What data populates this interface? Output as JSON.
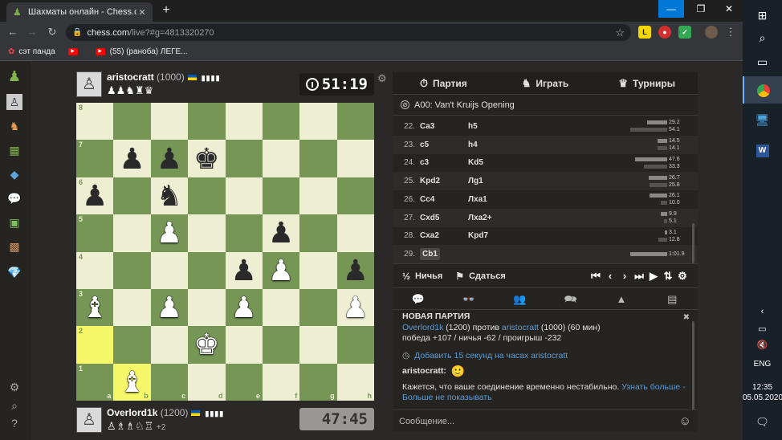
{
  "browser": {
    "tab_title": "Шахматы онлайн - Chess.com",
    "url_host": "chess.com",
    "url_path": "/live?#g=4813320270",
    "bookmarks": [
      "сэт панда",
      "",
      "(55) (раноба) ЛЕГЕ..."
    ]
  },
  "system": {
    "lang": "ENG",
    "time": "12:35",
    "date": "05.05.2020"
  },
  "top_player": {
    "name": "aristocratt",
    "rating": "(1000)",
    "captured": "♟♟♞♜♛",
    "clock": "51:19"
  },
  "bottom_player": {
    "name": "Overlord1k",
    "rating": "(1200)",
    "captured": "♙♗♗♘♖",
    "plus": "+2",
    "clock": "47:45"
  },
  "board": {
    "ranks": [
      "8",
      "7",
      "6",
      "5",
      "4",
      "3",
      "2",
      "1"
    ],
    "files": [
      "a",
      "b",
      "c",
      "d",
      "e",
      "f",
      "g",
      "h"
    ],
    "highlight": [
      "a2",
      "b1"
    ],
    "pieces": {
      "b7": "bp",
      "c7": "bp",
      "d7": "bk",
      "a6": "bp",
      "c6": "bn",
      "c5": "wp",
      "f5": "bp",
      "e4": "bp",
      "f4": "wp",
      "h4": "bp",
      "a3": "wb",
      "c3": "wp",
      "e3": "wp",
      "h3": "wp",
      "d2": "wk",
      "b1": "wb"
    }
  },
  "tabs": [
    {
      "icon": "⏱",
      "label": "Партия"
    },
    {
      "icon": "♞",
      "label": "Играть"
    },
    {
      "icon": "♛",
      "label": "Турниры"
    }
  ],
  "opening": "A00: Van't Kruijs Opening",
  "moves": [
    {
      "n": "22.",
      "w": "Ca3",
      "b": "h5",
      "tw": "29.2",
      "tb": "54.1",
      "fw": 0.54,
      "fb": 1.0
    },
    {
      "n": "23.",
      "w": "c5",
      "b": "h4",
      "tw": "14.5",
      "tb": "14.1",
      "fw": 0.27,
      "fb": 0.26
    },
    {
      "n": "24.",
      "w": "c3",
      "b": "Kd5",
      "tw": "47.6",
      "tb": "33.3",
      "fw": 0.88,
      "fb": 0.62
    },
    {
      "n": "25.",
      "w": "Kpd2",
      "b": "Лg1",
      "tw": "26.7",
      "tb": "25.8",
      "fw": 0.49,
      "fb": 0.48
    },
    {
      "n": "26.",
      "w": "Cc4",
      "b": "Лxa1",
      "tw": "26.1",
      "tb": "10.0",
      "fw": 0.48,
      "fb": 0.18
    },
    {
      "n": "27.",
      "w": "Cxd5",
      "b": "Лxa2+",
      "tw": "9.9",
      "tb": "5.1",
      "fw": 0.18,
      "fb": 0.09
    },
    {
      "n": "28.",
      "w": "Cxa2",
      "b": "Kpd7",
      "tw": "3.1",
      "tb": "12.8",
      "fw": 0.06,
      "fb": 0.24
    },
    {
      "n": "29.",
      "w": "Cb1",
      "b": "",
      "tw": "1:01.9",
      "tb": "",
      "fw": 1.0,
      "fb": 0
    }
  ],
  "controls": {
    "draw": "Ничья",
    "resign": "Сдаться"
  },
  "chat": {
    "header": "НОВАЯ ПАРТИЯ",
    "p1": "Overlord1k",
    "p1_rating": "(1200)",
    "vs": "против",
    "p2": "aristocratt",
    "p2_rating": "(1000) (60 мин)",
    "stakes": "победа +107 / ничья -62 / проигрыш -232",
    "add_time": "Добавить 15 секунд на часах aristocratt",
    "msg_user": "aristocratt:",
    "msg_emoji": "🙂",
    "notice": "Кажется, что ваше соединение временно нестабильно.",
    "learn_more": "Узнать больше",
    "dont_show": "Больше не показывать",
    "placeholder": "Сообщение..."
  }
}
